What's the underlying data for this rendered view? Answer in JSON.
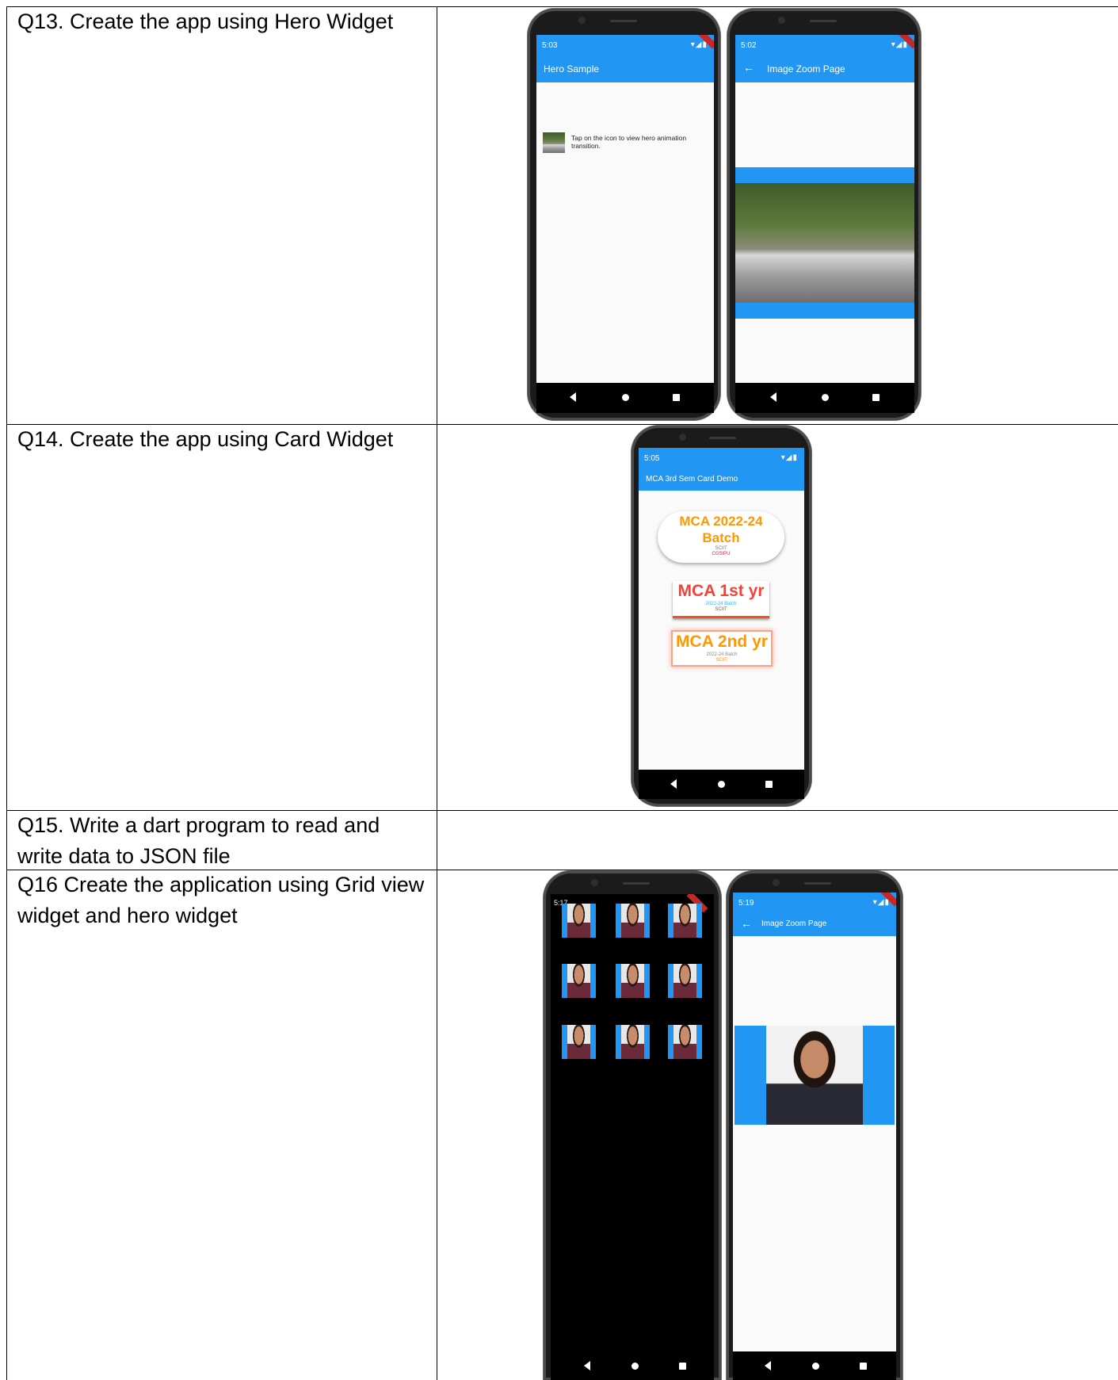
{
  "rows": [
    {
      "question": "Q13. Create the app using Hero Widget"
    },
    {
      "question": "Q14. Create the app using Card Widget"
    },
    {
      "question": "Q15. Write a dart program to read and write data to JSON file"
    },
    {
      "question": "Q16 Create the application using Grid view widget and hero widget"
    }
  ],
  "q13": {
    "phone1": {
      "time": "5:03",
      "title": "Hero Sample",
      "tile_text": "Tap on the icon to view hero animation transition."
    },
    "phone2": {
      "time": "5:02",
      "title": "Image Zoom Page"
    }
  },
  "q14": {
    "phone": {
      "time": "5:05",
      "title": "MCA 3rd Sem Card Demo"
    },
    "card1": {
      "title_line1": "MCA 2022-24",
      "title_line2": "Batch",
      "sub1": "SCIIT",
      "sub2": "CGSIPU"
    },
    "card2": {
      "title": "MCA 1st yr",
      "sub1": "2022-24 Batch",
      "sub2": "SCIIT"
    },
    "card3": {
      "title": "MCA 2nd yr",
      "sub1": "2022-24 Batch",
      "sub2": "SCIIT"
    }
  },
  "q16": {
    "phone1": {
      "time": "5:17"
    },
    "phone2": {
      "time": "5:19",
      "title": "Image Zoom Page"
    }
  },
  "colors": {
    "appbar": "#2196f3",
    "card_orange": "#ff9800",
    "card_red": "#f44336"
  }
}
